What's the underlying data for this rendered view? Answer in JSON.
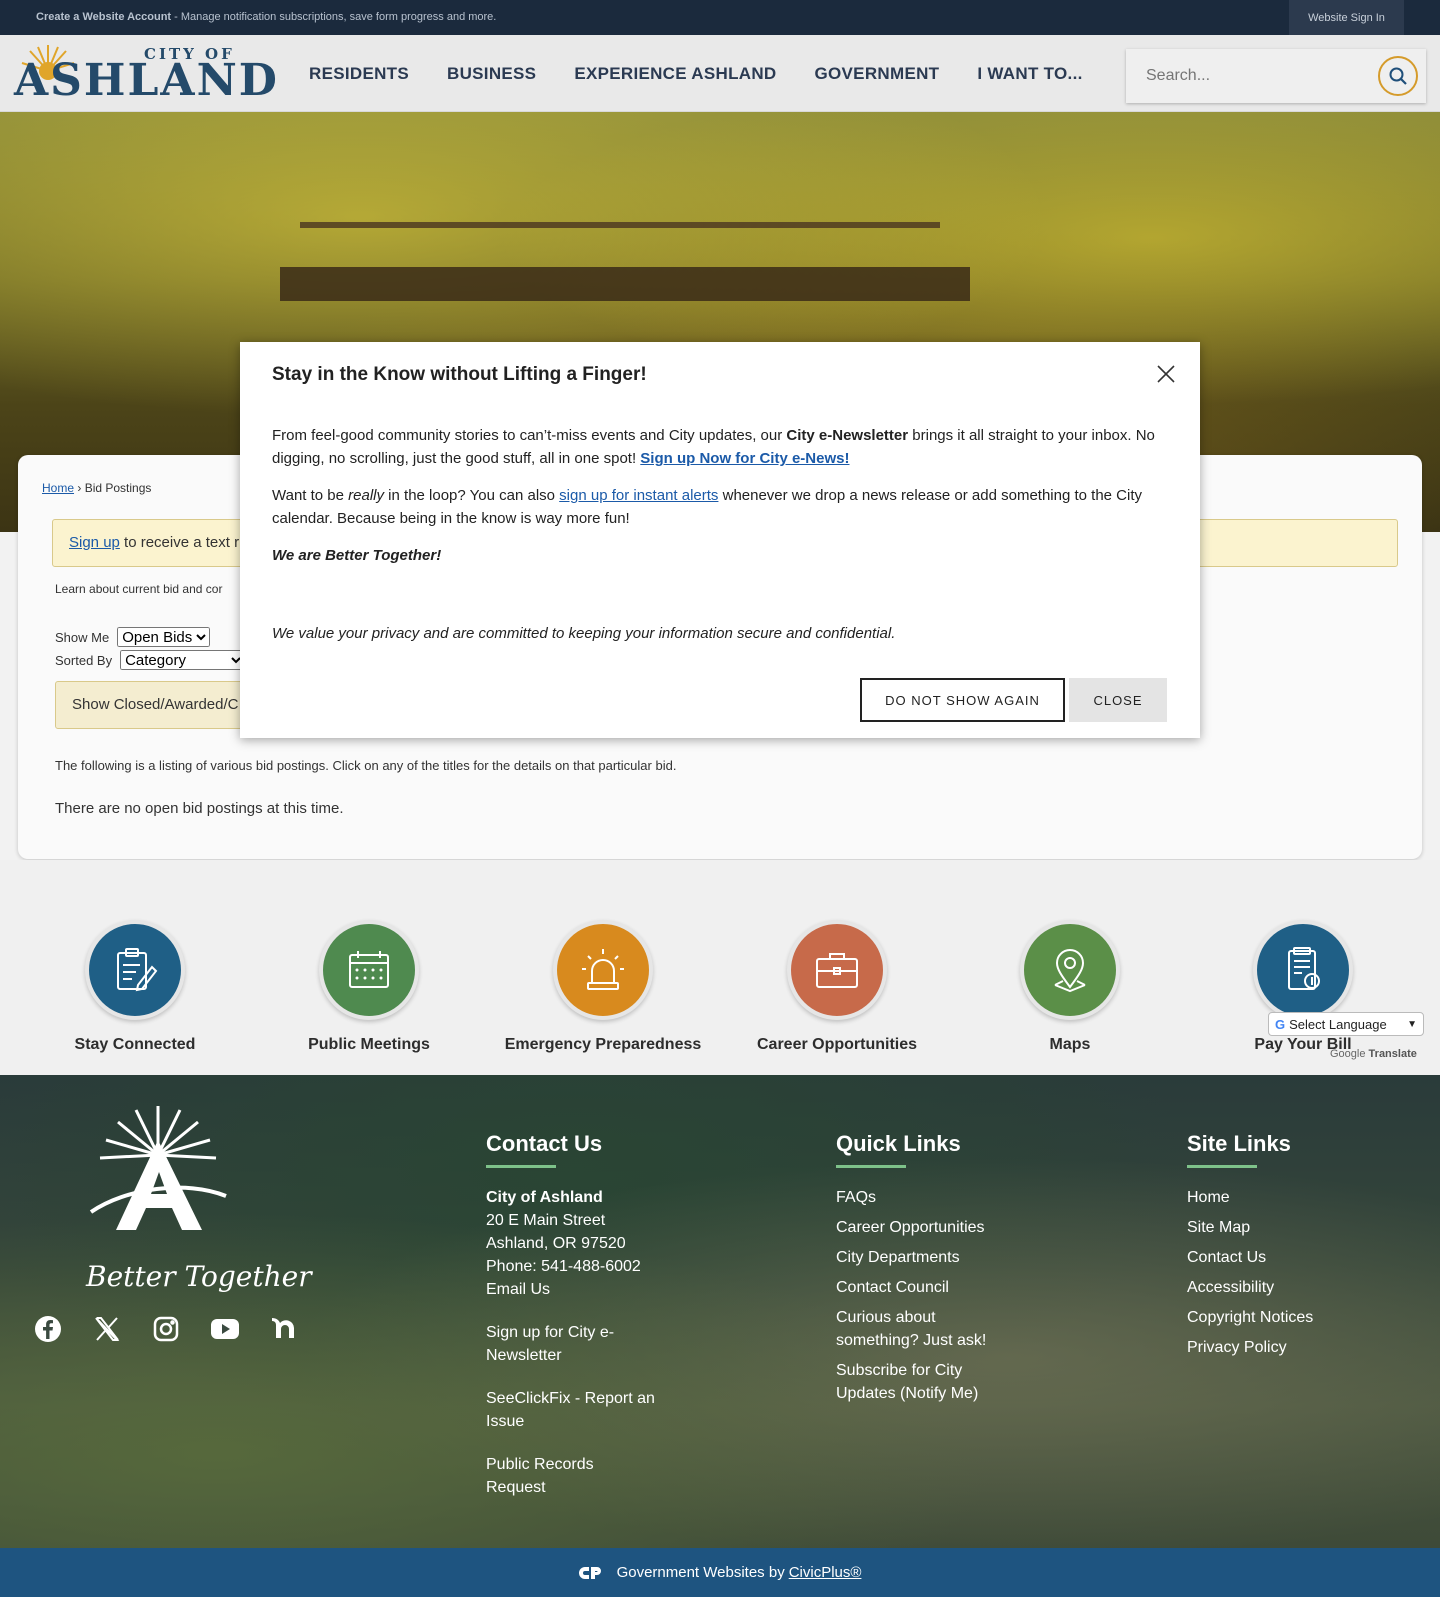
{
  "topbar": {
    "create_account": "Create a Website Account",
    "create_account_desc": " - Manage notification subscriptions, save form progress and more.",
    "sign_in": "Website Sign In"
  },
  "header": {
    "logo_city_of": "CITY OF",
    "logo_ashland": "ASHLAND",
    "nav": [
      "RESIDENTS",
      "BUSINESS",
      "EXPERIENCE ASHLAND",
      "GOVERNMENT",
      "I WANT TO..."
    ],
    "search_placeholder": "Search..."
  },
  "content": {
    "breadcrumb_home": "Home",
    "breadcrumb_sep": " › ",
    "breadcrumb_current": "Bid Postings",
    "alert_link": "Sign up",
    "alert_text": " to receive a text r",
    "learn_text": "Learn about current bid and cor",
    "show_me_label": "Show Me",
    "show_me_value": "Open Bids",
    "sorted_by_label": "Sorted By",
    "sorted_by_value": "Category",
    "show_closed": "Show Closed/Awarded/C",
    "listing_text": "The following is a listing of various bid postings. Click on any of the titles for the details on that particular bid.",
    "no_bids": "There are no open bid postings at this time."
  },
  "quick_icons": [
    {
      "label": "Stay Connected",
      "icon": "clipboard-pen-icon",
      "color": "#1f5f86"
    },
    {
      "label": "Public Meetings",
      "icon": "calendar-icon",
      "color": "#4f8a4f"
    },
    {
      "label": "Emergency Preparedness",
      "icon": "alarm-siren-icon",
      "color": "#d88a1e"
    },
    {
      "label": "Career Opportunities",
      "icon": "briefcase-icon",
      "color": "#c76a4a"
    },
    {
      "label": "Maps",
      "icon": "map-pin-icon",
      "color": "#5b8f48"
    },
    {
      "label": "Pay Your Bill",
      "icon": "bill-icon",
      "color": "#1f5f86"
    }
  ],
  "translate": {
    "select_label": "Select Language",
    "google": "Google",
    "translate": "Translate"
  },
  "footer": {
    "tagline": "Better Together",
    "contact": {
      "title": "Contact Us",
      "org": "City of Ashland",
      "address1": "20 E Main Street",
      "address2": "Ashland, OR 97520",
      "phone": "Phone: 541-488-6002",
      "email": "Email Us",
      "links": [
        "Sign up for City e-Newsletter",
        "SeeClickFix - Report an Issue",
        "Public Records Request"
      ]
    },
    "quick_links": {
      "title": "Quick Links",
      "items": [
        "FAQs",
        "Career Opportunities",
        "City Departments",
        "Contact Council",
        "Curious about something? Just ask!",
        "Subscribe for City Updates (Notify Me)"
      ]
    },
    "site_links": {
      "title": "Site Links",
      "items": [
        "Home",
        "Site Map",
        "Contact Us",
        "Accessibility",
        "Copyright Notices",
        "Privacy Policy"
      ]
    },
    "social": [
      "facebook-icon",
      "x-twitter-icon",
      "instagram-icon",
      "youtube-icon",
      "nextdoor-icon"
    ]
  },
  "bottombar": {
    "text": "Government Websites by",
    "link": "CivicPlus®"
  },
  "modal": {
    "title": "Stay in the Know without Lifting a Finger!",
    "p1_a": "From feel-good community stories to can’t-miss events and City updates, our ",
    "p1_b": "City e-Newsletter",
    "p1_c": " brings it all straight to your inbox. No digging, no scrolling, just the good stuff, all in one spot! ",
    "p1_link": "Sign up Now for City e-News!",
    "p2_a": "Want to be ",
    "p2_em": "really",
    "p2_b": " in the loop? You can also ",
    "p2_link": "sign up for instant alerts",
    "p2_c": " whenever we drop a news release or add something to the City calendar. Because being in the know is way more fun!",
    "p3": "We are Better Together!",
    "privacy": "We value your privacy and are committed to keeping your information secure and confidential.",
    "btn_dont_show": "DO NOT SHOW AGAIN",
    "btn_close": "CLOSE"
  }
}
